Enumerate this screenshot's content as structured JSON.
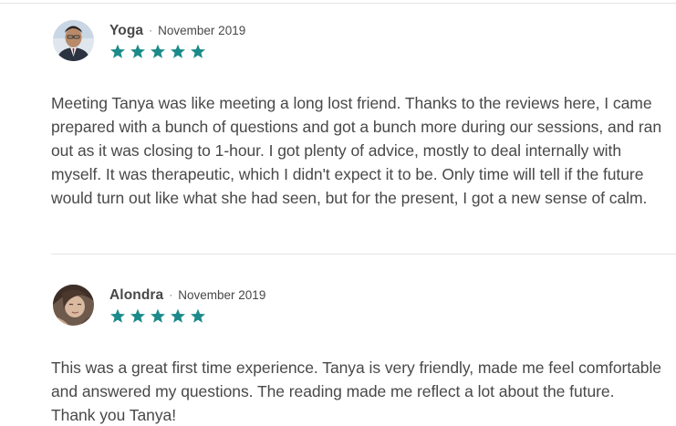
{
  "reviews": [
    {
      "name": "Yoga",
      "separator": "·",
      "date": "November 2019",
      "rating": 5,
      "text": "Meeting Tanya was like meeting a long lost friend. Thanks to the reviews here, I came prepared with a bunch of questions and got a bunch more during our sessions, and ran out as it was closing to 1-hour. I got plenty of advice, mostly to deal internally with myself. It was therapeutic, which I didn't expect it to be. Only time will tell if the future would turn out like what she had seen, but for the present, I got a new sense of calm."
    },
    {
      "name": "Alondra",
      "separator": "·",
      "date": "November 2019",
      "rating": 5,
      "text": "This was a great first time experience. Tanya is very friendly, made me feel comfortable and answered my questions. The reading made me reflect a lot about the future. Thank you Tanya!"
    }
  ],
  "colors": {
    "star": "#1d8a8a",
    "text": "#484848",
    "divider": "#e4e4e4"
  },
  "icons": {
    "star": "star-icon",
    "avatar": "avatar"
  }
}
